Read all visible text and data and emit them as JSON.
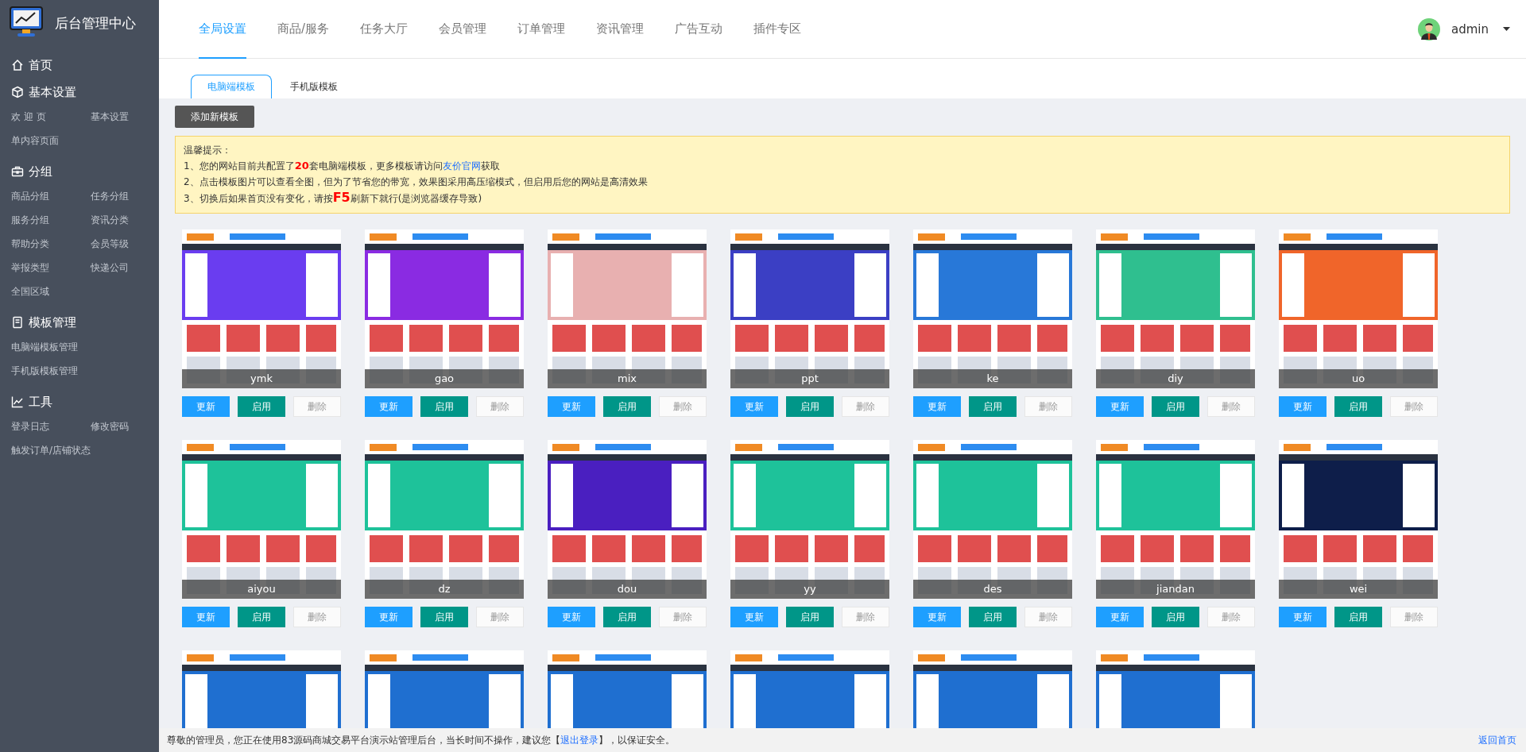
{
  "app": {
    "title": "后台管理中心"
  },
  "sidebar": [
    {
      "title": "首页"
    },
    {
      "title": "基本设置",
      "rows": [
        [
          "欢 迎 页",
          "基本设置"
        ],
        [
          "单内容页面"
        ]
      ]
    },
    {
      "title": "分组",
      "rows": [
        [
          "商品分组",
          "任务分组"
        ],
        [
          "服务分组",
          "资讯分类"
        ],
        [
          "帮助分类",
          "会员等级"
        ],
        [
          "举报类型",
          "快递公司"
        ],
        [
          "全国区域"
        ]
      ]
    },
    {
      "title": "模板管理",
      "rows": [
        [
          "电脑端模板管理"
        ],
        [
          "手机版模板管理"
        ]
      ]
    },
    {
      "title": "工具",
      "rows": [
        [
          "登录日志",
          "修改密码"
        ],
        [
          "触发订单/店铺状态"
        ]
      ]
    }
  ],
  "top_nav": [
    {
      "label": "全局设置",
      "selected": true
    },
    {
      "label": "商品/服务",
      "selected": false
    },
    {
      "label": "任务大厅",
      "selected": false
    },
    {
      "label": "会员管理",
      "selected": false
    },
    {
      "label": "订单管理",
      "selected": false
    },
    {
      "label": "资讯管理",
      "selected": false
    },
    {
      "label": "广告互动",
      "selected": false
    },
    {
      "label": "插件专区",
      "selected": false
    }
  ],
  "user": {
    "name": "admin"
  },
  "sub_tabs": [
    {
      "label": "电脑端模板",
      "selected": true
    },
    {
      "label": "手机版模板",
      "selected": false
    }
  ],
  "add_button": "添加新模板",
  "notice": {
    "title": "温馨提示：",
    "lines": [
      [
        {
          "kind": "plain",
          "text": "1、您的网站目前共配置了"
        },
        {
          "kind": "emph",
          "text": "20"
        },
        {
          "kind": "plain",
          "text": "套电脑端模板，更多模板请访问"
        },
        {
          "kind": "link",
          "text": "友价官网"
        },
        {
          "kind": "plain",
          "text": "获取"
        }
      ],
      [
        {
          "kind": "plain",
          "text": "2、点击模板图片可以查看全图，但为了节省您的带宽，效果图采用高压缩模式，但启用后您的网站是高清效果"
        }
      ],
      [
        {
          "kind": "plain",
          "text": "3、切换后如果首页没有变化，请按"
        },
        {
          "kind": "key",
          "text": "F5"
        },
        {
          "kind": "plain",
          "text": "刷新下就行(是浏览器缓存导致)"
        }
      ]
    ]
  },
  "templates": [
    {
      "name": "ymk",
      "buttons": [
        {
          "label": "更新",
          "kind": "primary",
          "disabled": false
        },
        {
          "label": "启用",
          "kind": "success",
          "disabled": false
        },
        {
          "label": "删除",
          "kind": "default",
          "disabled": true
        }
      ]
    },
    {
      "name": "gao",
      "buttons": [
        {
          "label": "更新",
          "kind": "primary",
          "disabled": false
        },
        {
          "label": "启用",
          "kind": "success",
          "disabled": false
        },
        {
          "label": "删除",
          "kind": "default",
          "disabled": true
        }
      ]
    },
    {
      "name": "mix",
      "buttons": [
        {
          "label": "更新",
          "kind": "primary",
          "disabled": false
        },
        {
          "label": "启用",
          "kind": "success",
          "disabled": false
        },
        {
          "label": "删除",
          "kind": "default",
          "disabled": true
        }
      ]
    },
    {
      "name": "ppt",
      "buttons": [
        {
          "label": "更新",
          "kind": "primary",
          "disabled": false
        },
        {
          "label": "启用",
          "kind": "success",
          "disabled": false
        },
        {
          "label": "删除",
          "kind": "default",
          "disabled": true
        }
      ]
    },
    {
      "name": "ke",
      "buttons": [
        {
          "label": "更新",
          "kind": "primary",
          "disabled": false
        },
        {
          "label": "启用",
          "kind": "success",
          "disabled": false
        },
        {
          "label": "删除",
          "kind": "default",
          "disabled": true
        }
      ]
    },
    {
      "name": "diy",
      "buttons": [
        {
          "label": "更新",
          "kind": "primary",
          "disabled": false
        },
        {
          "label": "启用",
          "kind": "success",
          "disabled": false
        },
        {
          "label": "删除",
          "kind": "default",
          "disabled": true
        }
      ]
    },
    {
      "name": "uo",
      "buttons": [
        {
          "label": "更新",
          "kind": "primary",
          "disabled": false
        },
        {
          "label": "启用",
          "kind": "success",
          "disabled": false
        },
        {
          "label": "删除",
          "kind": "default",
          "disabled": true
        }
      ]
    },
    {
      "name": "aiyou",
      "buttons": [
        {
          "label": "更新",
          "kind": "primary",
          "disabled": false
        },
        {
          "label": "启用",
          "kind": "success",
          "disabled": false
        },
        {
          "label": "删除",
          "kind": "default",
          "disabled": true
        }
      ]
    },
    {
      "name": "dz",
      "buttons": [
        {
          "label": "更新",
          "kind": "primary",
          "disabled": false
        },
        {
          "label": "启用",
          "kind": "success",
          "disabled": false
        },
        {
          "label": "删除",
          "kind": "default",
          "disabled": true
        }
      ]
    },
    {
      "name": "dou",
      "buttons": [
        {
          "label": "更新",
          "kind": "primary",
          "disabled": false
        },
        {
          "label": "启用",
          "kind": "success",
          "disabled": false
        },
        {
          "label": "删除",
          "kind": "default",
          "disabled": true
        }
      ]
    },
    {
      "name": "yy",
      "buttons": [
        {
          "label": "更新",
          "kind": "primary",
          "disabled": false
        },
        {
          "label": "启用",
          "kind": "success",
          "disabled": false
        },
        {
          "label": "删除",
          "kind": "default",
          "disabled": true
        }
      ]
    },
    {
      "name": "des",
      "buttons": [
        {
          "label": "更新",
          "kind": "primary",
          "disabled": false
        },
        {
          "label": "启用",
          "kind": "success",
          "disabled": false
        },
        {
          "label": "删除",
          "kind": "default",
          "disabled": true
        }
      ]
    },
    {
      "name": "jiandan",
      "buttons": [
        {
          "label": "更新",
          "kind": "primary",
          "disabled": false
        },
        {
          "label": "启用",
          "kind": "success",
          "disabled": false
        },
        {
          "label": "删除",
          "kind": "default",
          "disabled": true
        }
      ]
    },
    {
      "name": "wei",
      "buttons": [
        {
          "label": "更新",
          "kind": "primary",
          "disabled": false
        },
        {
          "label": "启用",
          "kind": "success",
          "disabled": false
        },
        {
          "label": "删除",
          "kind": "default",
          "disabled": true
        }
      ]
    },
    {
      "kind": "preview"
    },
    {
      "kind": "preview"
    },
    {
      "kind": "preview"
    },
    {
      "kind": "preview"
    },
    {
      "kind": "preview"
    },
    {
      "kind": "preview"
    }
  ],
  "footer": {
    "message": [
      {
        "kind": "plain",
        "text": "尊敬的管理员，您正在使用83源码商城交易平台演示站管理后台，当长时间不操作，建议您【"
      },
      {
        "kind": "link",
        "text": "退出登录"
      },
      {
        "kind": "plain",
        "text": "】，以保证安全。"
      }
    ],
    "home_link": "返回首页"
  }
}
